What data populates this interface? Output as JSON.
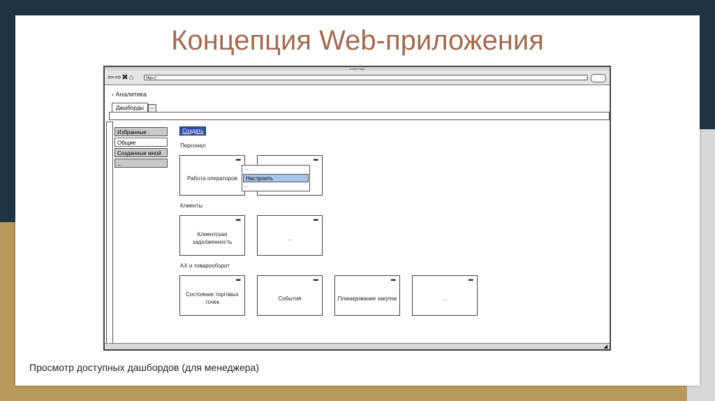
{
  "slide": {
    "title": "Концепция Web-приложения",
    "caption": "Просмотр доступных дашбордов (для менеджера)"
  },
  "browser": {
    "window_title": "A Web Page",
    "nav_icons": "⇦⇨✖⌂",
    "url": "https://"
  },
  "app": {
    "back_label": "‹ Аналитика",
    "tabs": [
      {
        "label": "Дашборды"
      },
      {
        "label": "..."
      }
    ],
    "sidebar_items": [
      {
        "label": "Избранные"
      },
      {
        "label": "Общие"
      },
      {
        "label": "Созданные мной"
      },
      {
        "label": "..."
      }
    ],
    "create_button": "Создать",
    "card_menu": "•••",
    "sections": [
      {
        "title": "Персонал",
        "cards": [
          "Работа операторов",
          ""
        ]
      },
      {
        "title": "Клиенты",
        "cards": [
          "Клиентская задолженность",
          "..."
        ]
      },
      {
        "title": "АХ и товарооборот",
        "cards": [
          "Состояние торговых точек",
          "События",
          "Планирование закупок",
          "..."
        ]
      }
    ],
    "dropdown": {
      "top": "...",
      "item": "Настроить",
      "bottom": "..."
    }
  }
}
